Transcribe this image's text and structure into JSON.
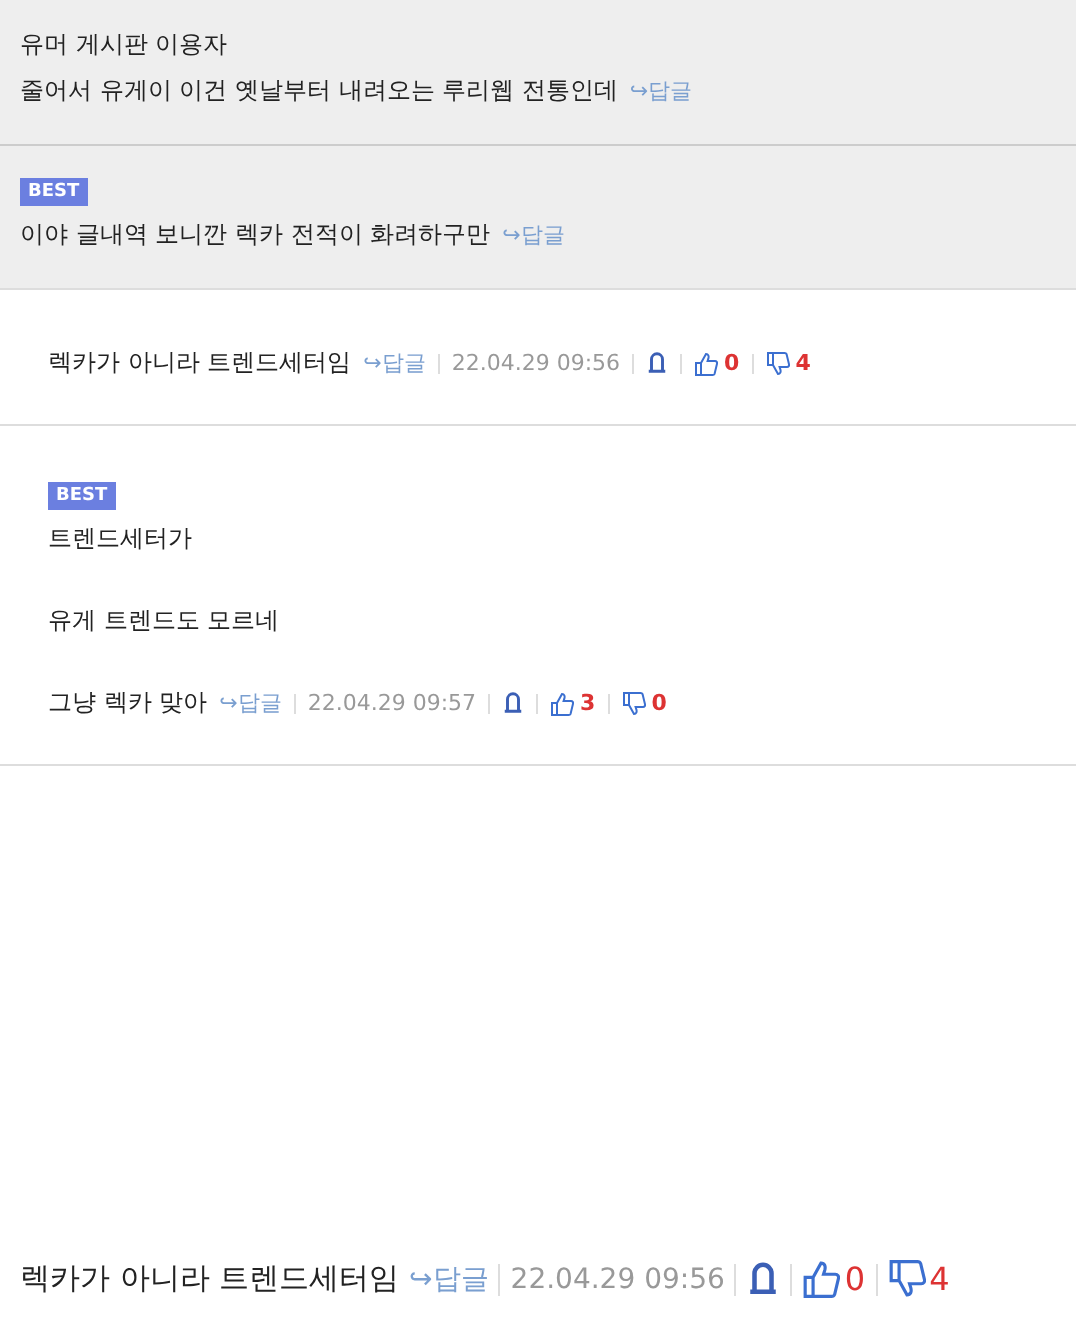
{
  "comments": [
    {
      "shaded": true,
      "indented": false,
      "lines": [
        "유머 게시판 이용자",
        "줄어서 유게이 이건 옛날부터 내려오는 루리웹 전통인데"
      ],
      "reply": "↪답글"
    },
    {
      "shaded": true,
      "indented": false,
      "badge": "BEST",
      "lines": [
        "이야 글내역 보니깐 렉카 전적이 화려하구만"
      ],
      "reply": "↪답글"
    },
    {
      "shaded": false,
      "indented": true,
      "lines": [
        "렉카가 아니라 트렌드세터임"
      ],
      "reply": "↪답글",
      "date": "22.04.29 09:56",
      "likes": "0",
      "dislikes": "4"
    },
    {
      "shaded": false,
      "indented": true,
      "badge": "BEST",
      "lines": [
        "트렌드세터가",
        "유게 트렌드도 모르네",
        "그냥 렉카 맞아"
      ],
      "reply": "↪답글",
      "date": "22.04.29 09:57",
      "likes": "3",
      "dislikes": "0"
    }
  ],
  "zoomed_line": {
    "text": "렉카가 아니라 트렌드세터임",
    "reply": "↪답글",
    "date": "22.04.29 09:56",
    "likes": "0",
    "dislikes": "4"
  }
}
